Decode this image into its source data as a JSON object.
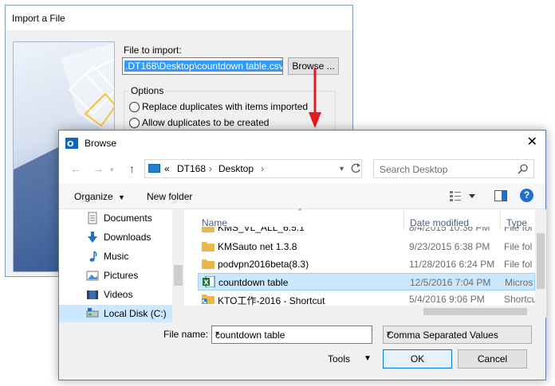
{
  "import_dialog": {
    "title": "Import a File",
    "file_to_import_label": "File to import:",
    "file_path_value": ".DT168\\Desktop\\countdown table.csv",
    "browse_label": "Browse ...",
    "options_label": "Options",
    "option_replace": "Replace duplicates with items imported",
    "option_allow": "Allow duplicates to be created"
  },
  "browse_dialog": {
    "title": "Browse",
    "close_glyph": "✕",
    "address": {
      "prefix": "«",
      "crumb1": "DT168",
      "crumb2": "Desktop",
      "sep": "›"
    },
    "search_placeholder": "Search Desktop",
    "command_bar": {
      "organize": "Organize",
      "new_folder": "New folder"
    },
    "nav_items": [
      {
        "label": "Documents",
        "icon": "documents-icon"
      },
      {
        "label": "Downloads",
        "icon": "downloads-icon"
      },
      {
        "label": "Music",
        "icon": "music-icon"
      },
      {
        "label": "Pictures",
        "icon": "pictures-icon"
      },
      {
        "label": "Videos",
        "icon": "videos-icon"
      },
      {
        "label": "Local Disk (C:)",
        "icon": "local-disk-icon"
      }
    ],
    "columns": {
      "name": "Name",
      "date": "Date modified",
      "type": "Type"
    },
    "files": [
      {
        "name": "KMS_VL_ALL_6.5.1",
        "date": "8/4/2015 10:36 PM",
        "type": "File fol"
      },
      {
        "name": "KMSauto net 1.3.8",
        "date": "9/23/2015 6:38 PM",
        "type": "File fol"
      },
      {
        "name": "podvpn2016beta(8.3)",
        "date": "11/28/2016 6:24 PM",
        "type": "File fol"
      },
      {
        "name": "countdown table",
        "date": "12/5/2016 7:04 PM",
        "type": "Micros"
      },
      {
        "name": "KTO工作-2016 - Shortcut",
        "date": "5/4/2016 9:06 PM",
        "type": "Shortcu"
      }
    ],
    "file_name_label": "File name:",
    "file_name_value": "countdown table",
    "file_type_value": "Comma Separated Values",
    "tools_label": "Tools",
    "ok_label": "OK",
    "cancel_label": "Cancel"
  },
  "colors": {
    "accent": "#0078d7",
    "selection": "#cce8ff",
    "highlight_arrow": "#e8191c"
  }
}
